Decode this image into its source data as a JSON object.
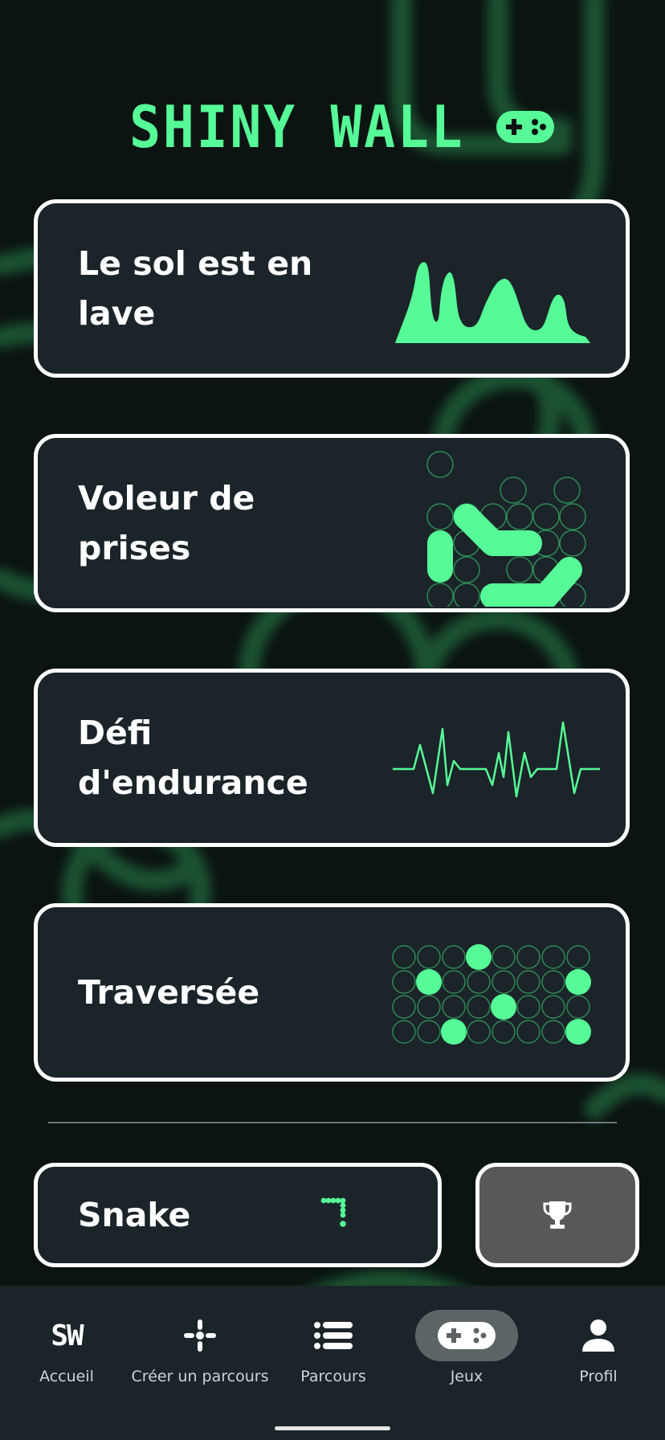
{
  "app": {
    "logo_text": "SHINY WALL",
    "accent_color": "#56fa96"
  },
  "games": [
    {
      "title": "Le sol est en lave",
      "art": "lava-waves"
    },
    {
      "title": "Voleur de prises",
      "art": "hold-path-grid"
    },
    {
      "title": "Défi d'endurance",
      "art": "heartbeat-line"
    },
    {
      "title": "Traversée",
      "art": "dot-grid"
    }
  ],
  "extra": {
    "snake_label": "Snake",
    "trophy_icon": "trophy-icon"
  },
  "nav": {
    "items": [
      {
        "label": "Accueil",
        "icon": "sw-logo-icon",
        "active": false
      },
      {
        "label": "Créer un parcours",
        "icon": "crosshair-icon",
        "active": false
      },
      {
        "label": "Parcours",
        "icon": "list-icon",
        "active": false
      },
      {
        "label": "Jeux",
        "icon": "gamepad-icon",
        "active": true
      },
      {
        "label": "Profil",
        "icon": "person-icon",
        "active": false
      }
    ]
  },
  "colors": {
    "background": "#0c1412",
    "card": "#1b2429",
    "card_border": "#ffffff",
    "trophy_button": "#585858",
    "nav_bar": "#1b2429"
  }
}
